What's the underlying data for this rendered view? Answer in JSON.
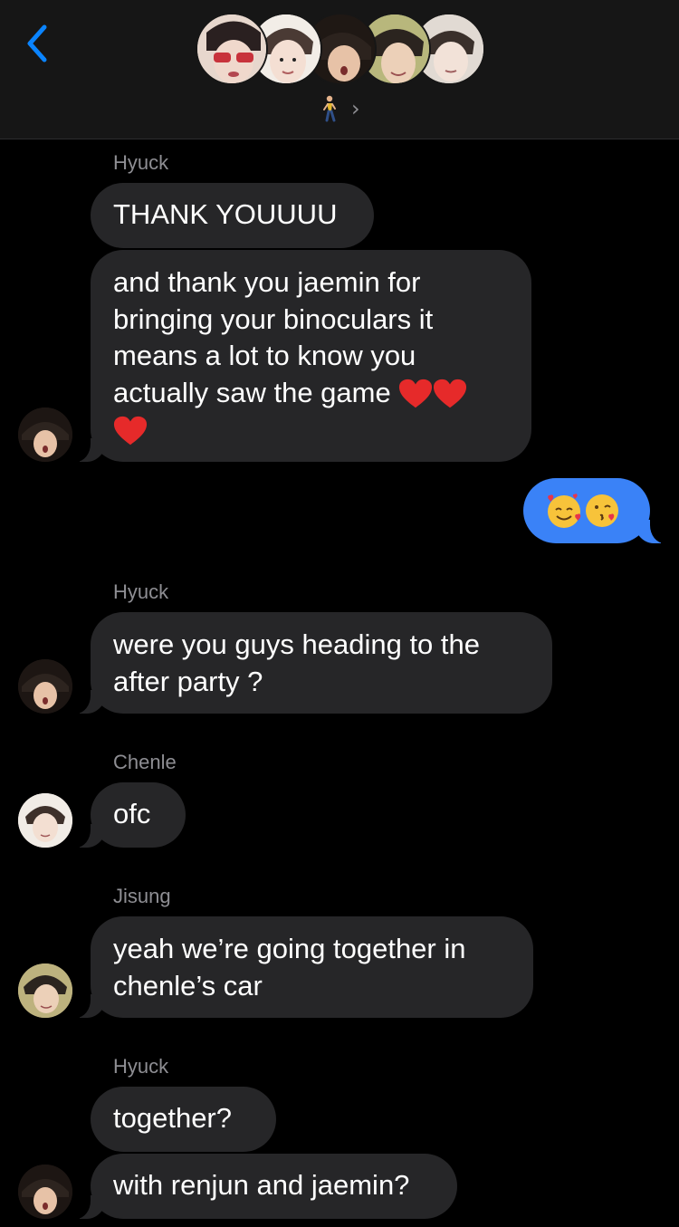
{
  "header": {
    "back_icon": "chevron-left-icon",
    "group_avatars": [
      {
        "name": "member-1",
        "color": "#d9c6bd"
      },
      {
        "name": "member-2",
        "color": "#e8e2dc"
      },
      {
        "name": "member-3",
        "color": "#2a211c"
      },
      {
        "name": "member-4",
        "color": "#9aa277"
      },
      {
        "name": "member-5",
        "color": "#dcd4cc"
      }
    ],
    "group_icon": "walking-person-icon",
    "chevron": "›"
  },
  "colors": {
    "incoming_bubble": "#262628",
    "outgoing_bubble": "#3a82f7",
    "back_accent": "#0a84ff",
    "sender_label": "#8e8e93"
  },
  "messages": [
    {
      "sender": "Hyuck",
      "text": "THANK YOUUUU"
    },
    {
      "text_lines": [
        "and thank you jaemin for",
        "bringing your binoculars it",
        "means a lot to know you",
        "actually saw the game"
      ],
      "emoji": "red-heart-icon"
    },
    {
      "outgoing": true,
      "emoji": [
        "smiling-face-with-hearts-icon",
        "face-blowing-kiss-icon"
      ]
    },
    {
      "sender": "Hyuck",
      "text_lines": [
        "were you guys heading to the",
        "after party ?"
      ]
    },
    {
      "sender": "Chenle",
      "text": "ofc"
    },
    {
      "sender": "Jisung",
      "text_lines": [
        "yeah we’re going together in",
        "chenle’s car"
      ]
    },
    {
      "sender": "Hyuck",
      "text": "together?"
    },
    {
      "text": "with renjun and jaemin?"
    }
  ]
}
